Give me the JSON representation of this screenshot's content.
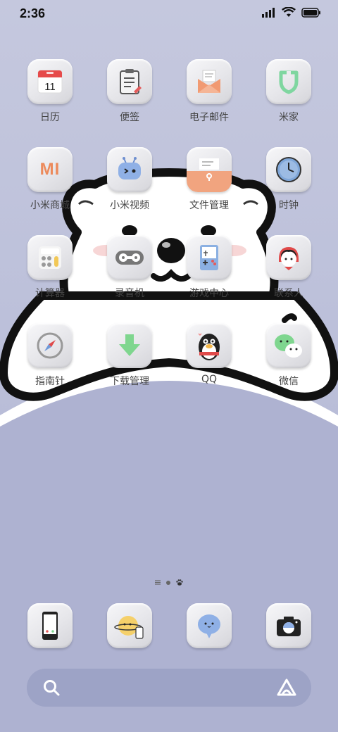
{
  "status": {
    "time": "2:36"
  },
  "apps": {
    "calendar": {
      "label": "日历",
      "date": "11"
    },
    "notes": {
      "label": "便签"
    },
    "email": {
      "label": "电子邮件"
    },
    "mihome": {
      "label": "米家"
    },
    "mistore": {
      "label": "小米商城",
      "logo_text": "MI"
    },
    "mivideo": {
      "label": "小米视频"
    },
    "files": {
      "label": "文件管理"
    },
    "clock": {
      "label": "时钟"
    },
    "calculator": {
      "label": "计算器"
    },
    "recorder": {
      "label": "录音机"
    },
    "gamecenter": {
      "label": "游戏中心"
    },
    "contacts": {
      "label": "联系人"
    },
    "compass": {
      "label": "指南针"
    },
    "downloads": {
      "label": "下载管理"
    },
    "qq": {
      "label": "QQ"
    },
    "wechat": {
      "label": "微信"
    }
  },
  "dock": [
    "phone",
    "browser",
    "messages",
    "camera"
  ],
  "colors": {
    "wallpaper": "#c3c6dd",
    "bear_outline": "#111111",
    "bear_fill": "#ffffff",
    "lower_panel": "#aeb2d1"
  }
}
